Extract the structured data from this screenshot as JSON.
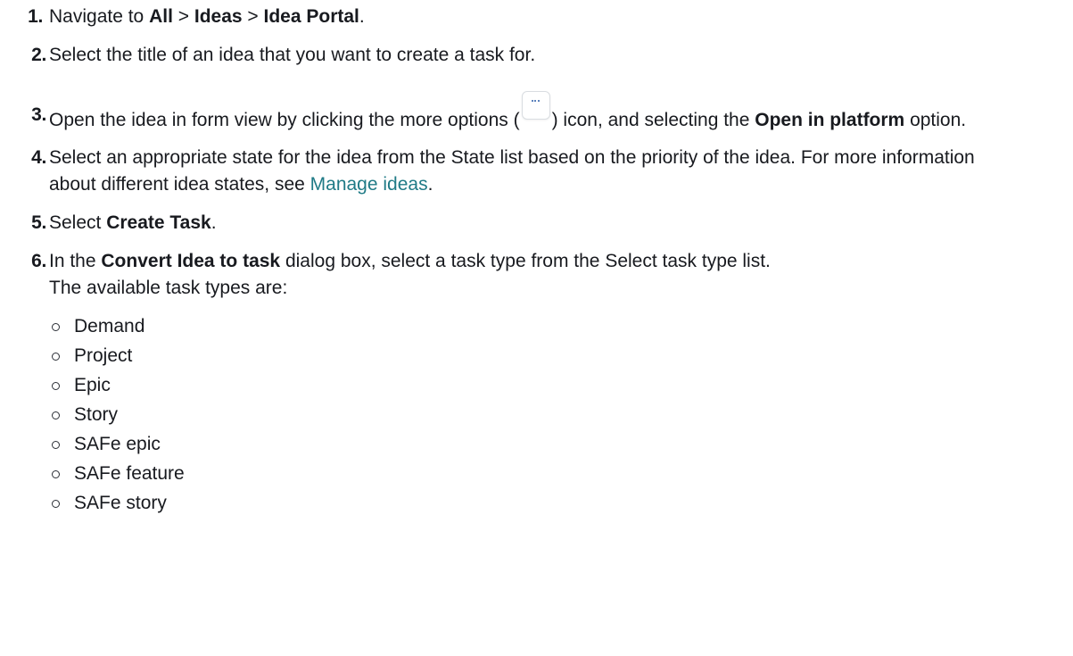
{
  "steps": [
    {
      "num": "1.",
      "parts": {
        "t1": "Navigate to ",
        "b1": "All",
        "t2": " > ",
        "b2": "Ideas",
        "t3": " > ",
        "b3": "Idea Portal",
        "t4": "."
      }
    },
    {
      "num": "2.",
      "text": "Select the title of an idea that you want to create a task for."
    },
    {
      "num": "3.",
      "parts": {
        "t1": "Open the idea in form view by clicking the more options (",
        "t2": ") icon, and selecting the ",
        "b1": "Open in platform",
        "t3": " option."
      }
    },
    {
      "num": "4.",
      "parts": {
        "t1": "Select an appropriate state for the idea from the State list based on the priority of the idea. For more information about different idea states, see ",
        "link": "Manage ideas",
        "t2": "."
      }
    },
    {
      "num": "5.",
      "parts": {
        "t1": "Select ",
        "b1": "Create Task",
        "t2": "."
      }
    },
    {
      "num": "6.",
      "parts": {
        "t1": "In the ",
        "b1": "Convert Idea to task",
        "t2": " dialog box, select a task type from the Select task type list.",
        "t3": "The available task types are:"
      },
      "task_types": [
        "Demand",
        "Project",
        "Epic",
        "Story",
        "SAFe epic",
        "SAFe feature",
        "SAFe story"
      ]
    }
  ],
  "icons": {
    "more_options": "more-options-icon"
  },
  "colors": {
    "text": "#181a1f",
    "link": "#1f7a86",
    "icon_dots": "#2a5ca8"
  }
}
